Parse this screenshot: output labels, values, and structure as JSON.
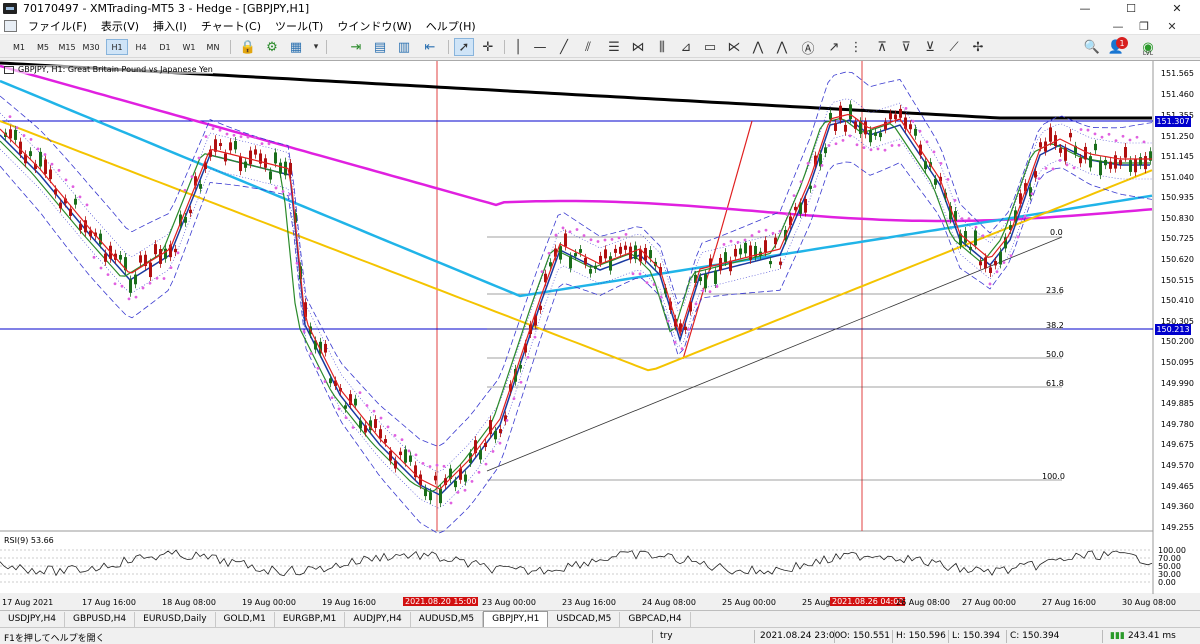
{
  "window": {
    "title": "70170497 - XMTrading-MT5 3 - Hedge - [GBPJPY,H1]",
    "minimize": "—",
    "maximize": "☐",
    "close": "✕",
    "mdi_min": "—",
    "mdi_restore": "❐",
    "mdi_close": "✕"
  },
  "menu": [
    "ファイル(F)",
    "表示(V)",
    "挿入(I)",
    "チャート(C)",
    "ツール(T)",
    "ウインドウ(W)",
    "ヘルプ(H)"
  ],
  "toolbar": {
    "timeframes": [
      "M1",
      "M5",
      "M15",
      "M30",
      "H1",
      "H4",
      "D1",
      "W1",
      "MN"
    ],
    "active_timeframe": "H1",
    "tools": [
      "algo-trading-icon",
      "indicators-icon",
      "chart-type-icon",
      "autoscroll-icon",
      "chart-shift-icon",
      "bars-icon",
      "candles-icon",
      "line-icon",
      "cursor-icon",
      "crosshair-icon",
      "vertical-line-icon",
      "horizontal-line-icon",
      "trendline-icon",
      "channel-icon",
      "fibonacci-icon",
      "text-icon",
      "rectangle-icon",
      "pitchfork-icon",
      "elliott-icon",
      "arrow-icon",
      "more-icon"
    ],
    "notification_count": "1",
    "signal_label": "LVL"
  },
  "chart": {
    "symbol_label": "GBPJPY, H1:  Great Britain Pound vs Japanese Yen",
    "price_ticks": [
      "151.565",
      "151.460",
      "151.355",
      "151.250",
      "151.145",
      "151.040",
      "150.935",
      "150.830",
      "150.725",
      "150.620",
      "150.515",
      "150.410",
      "150.305",
      "150.200",
      "150.095",
      "149.990",
      "149.885",
      "149.780",
      "149.675",
      "149.570",
      "149.465",
      "149.360",
      "149.255"
    ],
    "hline_prices": [
      "151.307",
      "150.213"
    ],
    "fib_levels": [
      "0.0",
      "23.6",
      "38.2",
      "50.0",
      "61.8",
      "100.0"
    ],
    "rsi_label": "RSI(9) 53.66",
    "rsi_ticks": [
      "100.00",
      "70.00",
      "50.00",
      "30.00",
      "0.00"
    ],
    "time_labels": [
      "17 Aug 2021",
      "17 Aug 16:00",
      "18 Aug 08:00",
      "19 Aug 00:00",
      "19 Aug 16:00",
      "23 Aug 00:00",
      "23 Aug 16:00",
      "24 Aug 08:00",
      "25 Aug 00:00",
      "25 Aug",
      "26 Aug 08:00",
      "27 Aug 00:00",
      "27 Aug 16:00",
      "30 Aug 08:00"
    ],
    "marker_times": [
      "2021.08.20 15:00",
      "2021.08.26 04:00"
    ],
    "colors": {
      "candle_up": "#1a6e1a",
      "candle_down": "#b01010",
      "sma_long": "#000000",
      "ema_magenta": "#e020e0",
      "ema_skyblue": "#20b4e8",
      "ema_yellow": "#f4c400",
      "bollinger": "#3a3ad0",
      "parabolic_sar": "#e060e0",
      "hline": "#0000cc",
      "vline": "#e04040"
    }
  },
  "tabs": [
    "USDJPY,H4",
    "GBPUSD,H4",
    "EURUSD,Daily",
    "GOLD,M1",
    "EURGBP,M1",
    "AUDJPY,H4",
    "AUDUSD,M5",
    "GBPJPY,H1",
    "USDCAD,M5",
    "GBPCAD,H4"
  ],
  "active_tab": "GBPJPY,H1",
  "status": {
    "help": "F1を押してヘルプを開く",
    "profile": "try",
    "datetime": "2021.08.24 23:00",
    "open": "O: 150.551",
    "high": "H: 150.596",
    "low": "L: 150.394",
    "close": "C: 150.394",
    "traffic": "243.41 ms"
  }
}
